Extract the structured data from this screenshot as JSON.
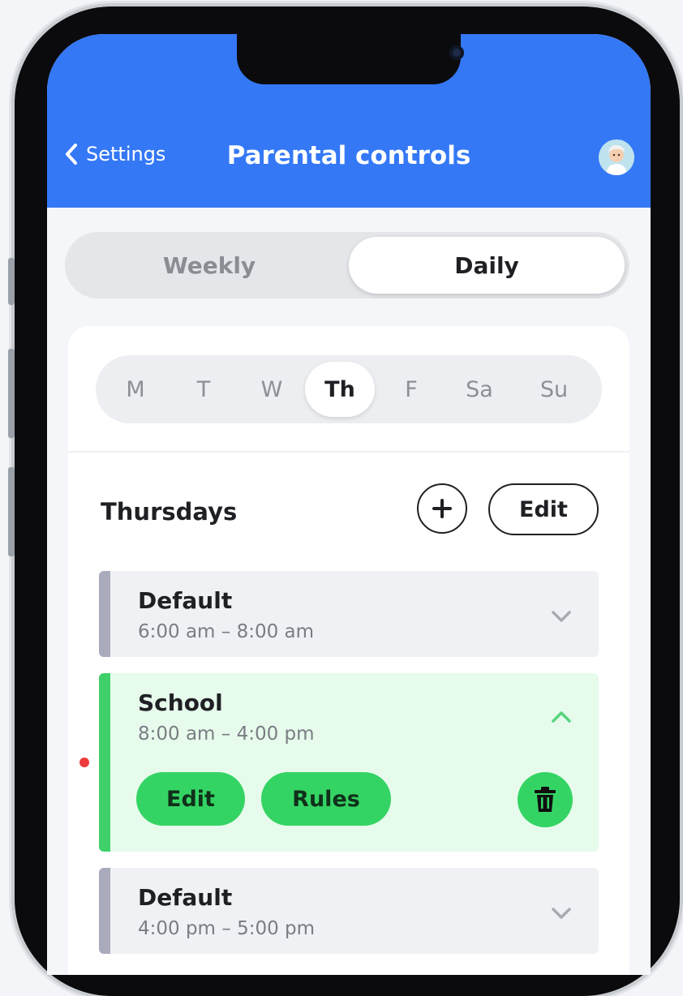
{
  "header": {
    "back_label": "Settings",
    "title": "Parental controls",
    "bg_color": "#3478f6"
  },
  "view_toggle": {
    "options": [
      "Weekly",
      "Daily"
    ],
    "selected": "Daily"
  },
  "days": {
    "items": [
      "M",
      "T",
      "W",
      "Th",
      "F",
      "Sa",
      "Su"
    ],
    "selected": "Th"
  },
  "section": {
    "title": "Thursdays",
    "add_icon": "plus-icon",
    "edit_label": "Edit"
  },
  "schedule": [
    {
      "name": "Default",
      "time": "6:00 am – 8:00 am",
      "expanded": false,
      "accent": "#a9abbd"
    },
    {
      "name": "School",
      "time": "8:00 am – 4:00 pm",
      "expanded": true,
      "accent": "#3fd06a",
      "actions": {
        "edit_label": "Edit",
        "rules_label": "Rules",
        "delete_icon": "trash-icon"
      }
    },
    {
      "name": "Default",
      "time": "4:00 pm – 5:00 pm",
      "expanded": false,
      "accent": "#a9abbd"
    }
  ]
}
